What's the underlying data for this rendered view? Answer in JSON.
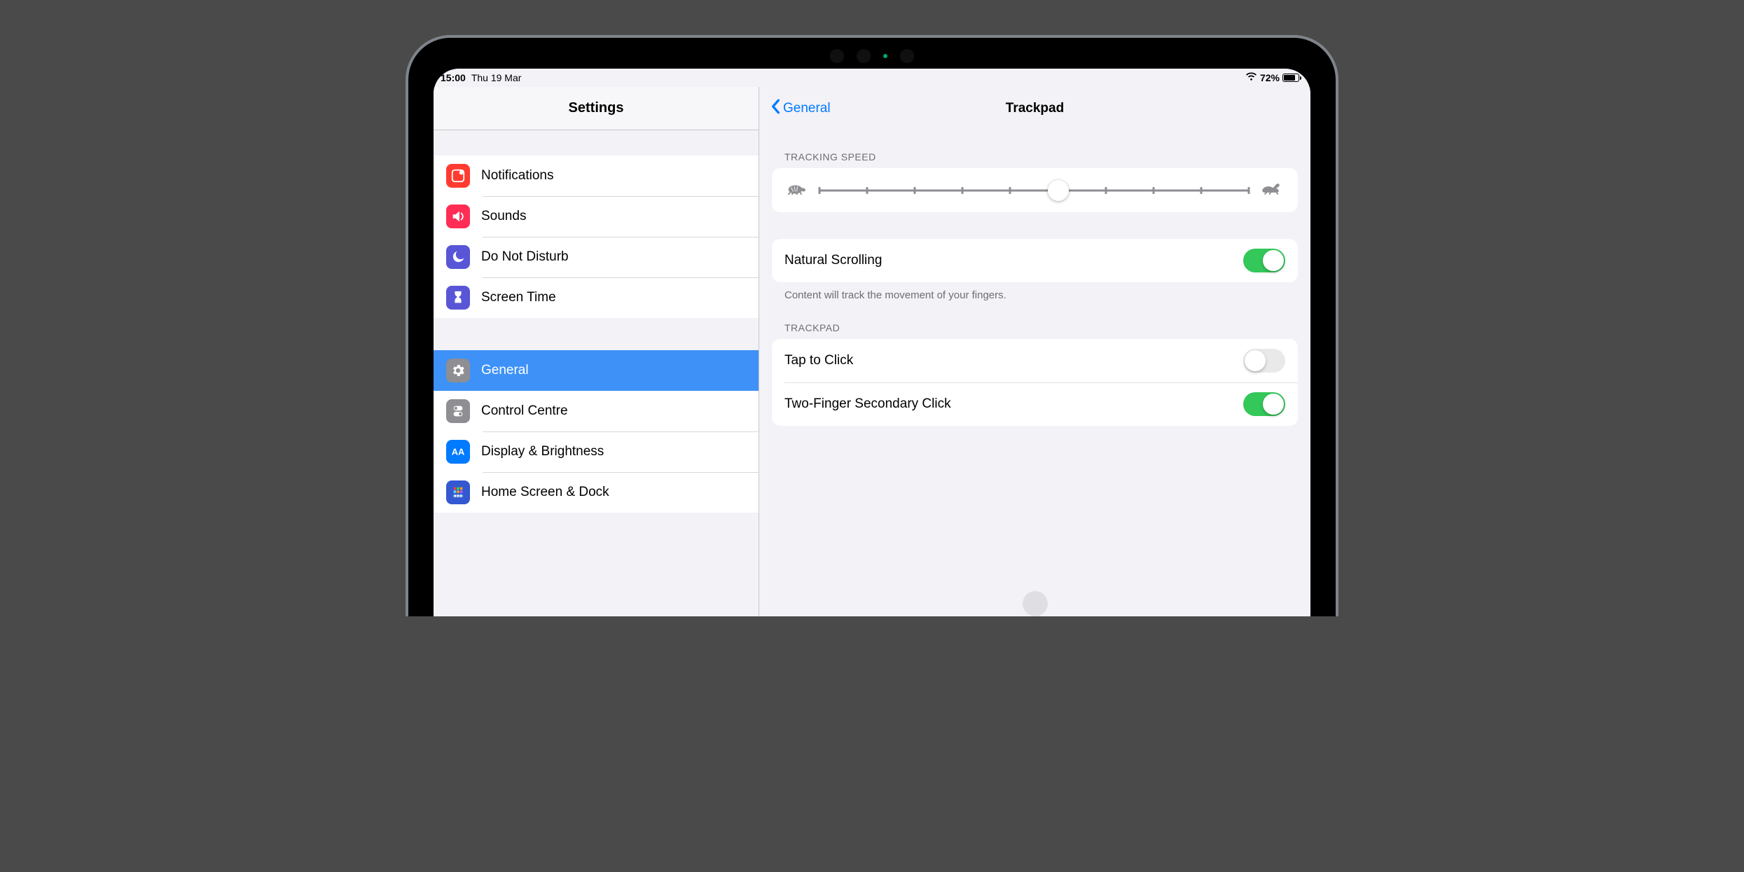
{
  "status": {
    "time": "15:00",
    "date": "Thu 19 Mar",
    "battery_percent": "72%"
  },
  "sidebar": {
    "title": "Settings",
    "items": [
      {
        "label": "Notifications",
        "icon": "notifications",
        "color": "#ff3b30"
      },
      {
        "label": "Sounds",
        "icon": "sounds",
        "color": "#ff2d55"
      },
      {
        "label": "Do Not Disturb",
        "icon": "dnd",
        "color": "#5856d6"
      },
      {
        "label": "Screen Time",
        "icon": "screentime",
        "color": "#5856d6"
      }
    ],
    "items2": [
      {
        "label": "General",
        "icon": "general",
        "color": "#8e8e93",
        "selected": true
      },
      {
        "label": "Control Centre",
        "icon": "controlcentre",
        "color": "#8e8e93"
      },
      {
        "label": "Display & Brightness",
        "icon": "display",
        "color": "#007aff"
      },
      {
        "label": "Home Screen & Dock",
        "icon": "homescreen",
        "color": "#3358d1"
      }
    ]
  },
  "detail": {
    "back_label": "General",
    "title": "Trackpad",
    "tracking_speed": {
      "header": "TRACKING SPEED",
      "value_index": 5,
      "ticks": 10
    },
    "natural_scrolling": {
      "label": "Natural Scrolling",
      "on": true,
      "note": "Content will track the movement of your fingers."
    },
    "trackpad_section": {
      "header": "TRACKPAD",
      "rows": [
        {
          "label": "Tap to Click",
          "on": false
        },
        {
          "label": "Two-Finger Secondary Click",
          "on": true
        }
      ]
    }
  }
}
